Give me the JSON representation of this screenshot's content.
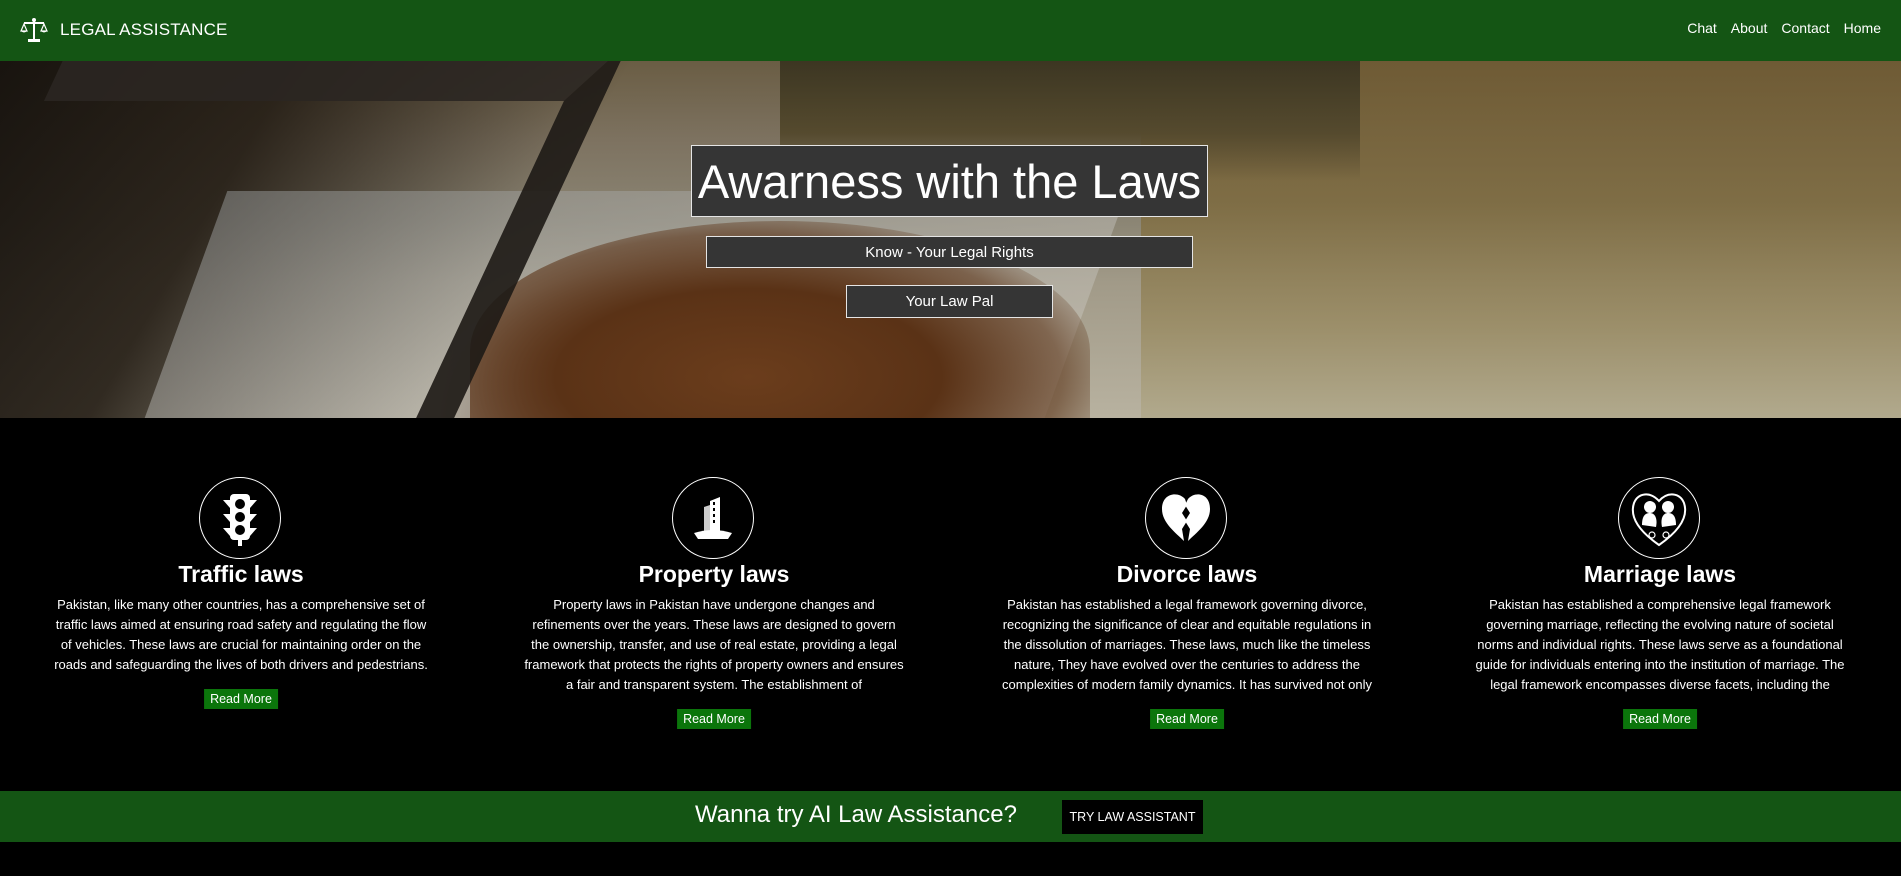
{
  "nav": {
    "brand": "LEGAL ASSISTANCE",
    "brand_icon": "scales-of-justice-icon",
    "links": [
      "Chat",
      "About",
      "Contact",
      "Home"
    ]
  },
  "hero": {
    "title": "Awarness with the Laws",
    "subtitle": "Know - Your Legal Rights",
    "button": "Your Law Pal"
  },
  "cards": [
    {
      "icon": "traffic-light-icon",
      "title": "Traffic laws",
      "text": "Pakistan, like many other countries, has a comprehensive set of traffic laws aimed at ensuring road safety and regulating the flow of vehicles. These laws are crucial for maintaining order on the roads and safeguarding the lives of both drivers and pedestrians.",
      "button": "Read More"
    },
    {
      "icon": "building-icon",
      "title": "Property laws",
      "text": "Property laws in Pakistan have undergone changes and refinements over the years. These laws are designed to govern the ownership, transfer, and use of real estate, providing a legal framework that protects the rights of property owners and ensures a fair and transparent system. The establishment of",
      "button": "Read More"
    },
    {
      "icon": "broken-heart-icon",
      "title": "Divorce laws",
      "text": "Pakistan has established a legal framework governing divorce, recognizing the significance of clear and equitable regulations in the dissolution of marriages. These laws, much like the timeless nature, They have evolved over the centuries to address the complexities of modern family dynamics. It has survived not only",
      "button": "Read More"
    },
    {
      "icon": "couple-heart-icon",
      "title": "Marriage laws",
      "text": "Pakistan has established a comprehensive legal framework governing marriage, reflecting the evolving nature of societal norms and individual rights. These laws serve as a foundational guide for individuals entering into the institution of marriage. The legal framework encompasses diverse facets, including the",
      "button": "Read More"
    }
  ],
  "cta": {
    "text": "Wanna try AI Law Assistance?",
    "button": "TRY LAW ASSISTANT"
  },
  "colors": {
    "nav_green": "#145514",
    "button_green": "#0b750b",
    "background": "#000000",
    "hero_box": "#353535"
  }
}
